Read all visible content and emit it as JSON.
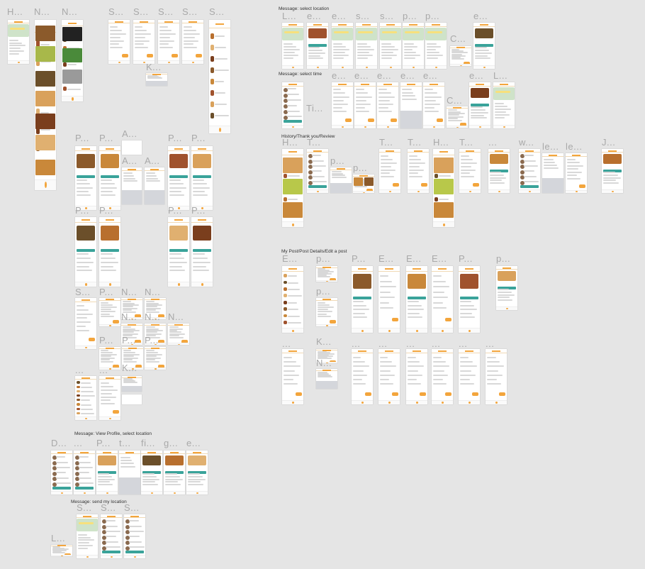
{
  "canvas": {
    "background": "#e5e5e5",
    "accent_color": "#f3a53c",
    "secondary_color": "#3aa39a",
    "section_titles": {
      "select_location": "Message: select location",
      "select_time": "Message: select time",
      "history": "History/Thank you/Review",
      "my_post": "My Post/Post Details/Edit a post",
      "view_profile": "Message: View Profile, select location",
      "send_location": "Message: send my location"
    },
    "frame_labels": {
      "home": "H...",
      "n1": "N...",
      "n2": "N...",
      "s1": "S...",
      "s2": "S...",
      "s3": "S...",
      "s4": "S...",
      "s5": "S...",
      "k1": "K...",
      "p1": "P...",
      "p2": "P...",
      "a1": "A...",
      "a2": "A...",
      "a3": "A...",
      "p3": "P...",
      "p4": "P...",
      "p5": "P...",
      "p6": "P...",
      "p7": "P...",
      "p8": "P...",
      "s6": "S...",
      "p9": "P...",
      "n3": "N...",
      "n4": "N...",
      "n5": "N...",
      "n6": "N...",
      "n7": "N...",
      "p10": "P...",
      "p11": "P...",
      "p12": "P...",
      "d1": "...",
      "d2": "...",
      "k2": "K...",
      "loc_l": "L...",
      "loc_e1": "e...",
      "loc_e2": "e...",
      "loc_s1": "s...",
      "loc_s2": "s...",
      "loc_p1": "p...",
      "loc_p2": "p...",
      "loc_e3": "e...",
      "loc_c": "C...",
      "time_e1": "e...",
      "time_e2": "e...",
      "time_e3": "e...",
      "time_e4": "e...",
      "time_e5": "e...",
      "time_e6": "e...",
      "time_l": "L...",
      "time_ti": "Ti...",
      "time_c": "C...",
      "hist_h1": "H...",
      "hist_t1": "T...",
      "hist_p1": "p...",
      "hist_p2": "p...",
      "hist_t2": "T...",
      "hist_t3": "T...",
      "hist_h2": "H...",
      "hist_t4": "T...",
      "hist_d": "...",
      "hist_w": "w...",
      "hist_le1": "le...",
      "hist_le2": "le...",
      "hist_j": "J...",
      "post_e1": "E...",
      "post_p1": "p...",
      "post_p2": "p...",
      "post_p3": "P...",
      "post_e2": "E...",
      "post_e3": "E...",
      "post_e4": "E...",
      "post_p4": "P...",
      "post_p5": "p...",
      "post_d1": "...",
      "post_k": "K...",
      "post_n": "N...",
      "post_d2": "...",
      "post_d3": "...",
      "post_d4": "...",
      "post_d5": "...",
      "post_d6": "...",
      "post_d7": "...",
      "post_d8": "...",
      "prof_d": "D...",
      "prof_dots": "...",
      "prof_p": "P...",
      "prof_t": "t...",
      "prof_fi": "fi...",
      "prof_g": "g...",
      "prof_e": "e...",
      "send_s1": "S...",
      "send_s2": "S...",
      "send_s3": "S...",
      "send_l": "L..."
    }
  }
}
